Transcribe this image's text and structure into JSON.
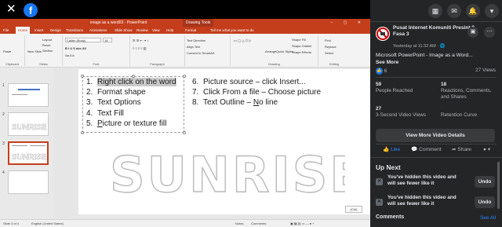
{
  "viewer": {
    "close_icon": "close-icon",
    "logo_letter": "f"
  },
  "powerpoint": {
    "title": "image as a word03 - PowerPoint",
    "drawing_tools": "Drawing Tools",
    "tabs": [
      "File",
      "Home",
      "Insert",
      "Design",
      "Transitions",
      "Animations",
      "Slide Show",
      "Review",
      "View",
      "Help",
      "Format",
      "Tell me what you want to do"
    ],
    "active_tab": "Home",
    "ribbon": {
      "paste": "Paste",
      "new_slide": "New Slide",
      "layout": "Layout",
      "reset": "Reset",
      "section": "Section",
      "font_name": "Calibri (Body)",
      "font_size": "18",
      "text_direction": "Text Direction",
      "align_text": "Align Text",
      "convert_smartart": "Convert to SmartArt",
      "arrange": "Arrange",
      "quick_styles": "Quick Styles",
      "shape_fill": "Shape Fill",
      "shape_outline": "Shape Outline",
      "shape_effects": "Shape Effects",
      "find": "Find",
      "replace": "Replace",
      "select": "Select",
      "groups": [
        "Clipboard",
        "Slides",
        "Font",
        "Paragraph",
        "Drawing",
        "Editing"
      ]
    },
    "slides": [
      {
        "num": "1",
        "title": ""
      },
      {
        "num": "2",
        "title": "SUNRISE"
      },
      {
        "num": "3",
        "title": "SUNRISE"
      },
      {
        "num": "4",
        "title": ""
      }
    ],
    "slide": {
      "list_left": [
        {
          "n": "1.",
          "pre": "",
          "hl": "Right click on the word",
          "post": ""
        },
        {
          "n": "2.",
          "pre": "Format shape",
          "hl": "",
          "post": ""
        },
        {
          "n": "3.",
          "pre": "Text Options",
          "hl": "",
          "post": ""
        },
        {
          "n": "4.",
          "pre": "Text Fill",
          "hl": "",
          "post": ""
        },
        {
          "n": "5.",
          "pre": "",
          "u": "P",
          "post": "icture or texture fill"
        }
      ],
      "list_right": [
        {
          "n": "6.",
          "text": "Picture  source –  click Insert..."
        },
        {
          "n": "7.",
          "text": "Click From a file – Choose picture"
        },
        {
          "n": "8.",
          "pre": "Text Outline – ",
          "u": "N",
          "post": "o line"
        }
      ],
      "word_art": "SUNRISE",
      "ctrl_label": "(Ctrl)"
    },
    "status": {
      "slide_of": "Slide 3 of 4",
      "language": "English (United States)",
      "notes": "Notes",
      "comments": "Comments"
    }
  },
  "facebook": {
    "page_name": "Pusat Internet Komuniti Presint 9 Fasa 3",
    "posted": "Yesterday at 11:32 AM ·",
    "post_title": "Microsoft PowerPoint - Image as a Word...",
    "see_more": "See More",
    "reactions": "6",
    "views": "27 Views",
    "stats": [
      {
        "num": "59",
        "label": "People Reached"
      },
      {
        "num": "18",
        "label": "Reactions, Comments, and Shares"
      },
      {
        "num": "27",
        "label": "3-Second Video Views"
      },
      {
        "num": "",
        "label": "Retention Curve"
      }
    ],
    "view_more_details": "View More Video Details",
    "actions": {
      "like": "Like",
      "comment": "Comment",
      "share": "Share"
    },
    "up_next": "Up Next",
    "hidden_items": [
      {
        "text": "You've hidden this video and will see fewer like it",
        "undo": "Undo"
      },
      {
        "text": "You've hidden this video and will see fewer like it",
        "undo": "Undo"
      }
    ],
    "comments_label": "Comments",
    "see_all": "See All",
    "accent": "#1877f2"
  }
}
